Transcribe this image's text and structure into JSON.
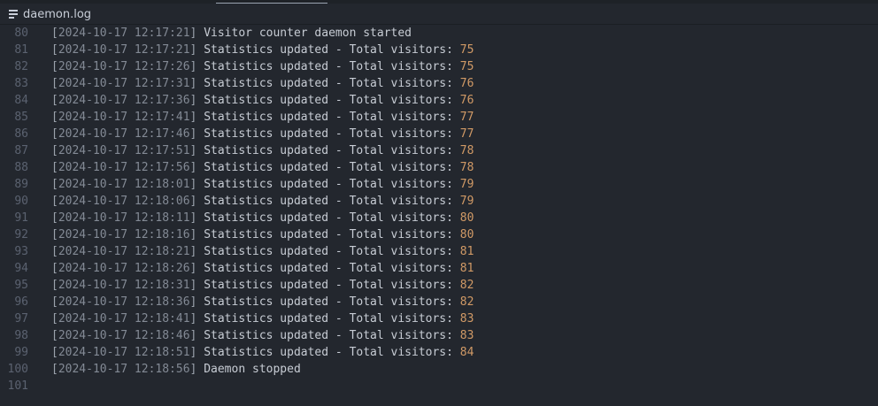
{
  "tab": {
    "filename": "daemon.log",
    "icon": "file-lines-icon"
  },
  "colors": {
    "background": "#23272e",
    "text": "#c7ccd4",
    "timestamp": "#838a95",
    "number": "#d19a66",
    "line_number": "#5b6270"
  },
  "lines": [
    {
      "num": "80",
      "ts": "2024-10-17 12:17:21",
      "msg": "Visitor counter daemon started",
      "value": ""
    },
    {
      "num": "81",
      "ts": "2024-10-17 12:17:21",
      "msg": "Statistics updated - Total visitors: ",
      "value": "75"
    },
    {
      "num": "82",
      "ts": "2024-10-17 12:17:26",
      "msg": "Statistics updated - Total visitors: ",
      "value": "75"
    },
    {
      "num": "83",
      "ts": "2024-10-17 12:17:31",
      "msg": "Statistics updated - Total visitors: ",
      "value": "76"
    },
    {
      "num": "84",
      "ts": "2024-10-17 12:17:36",
      "msg": "Statistics updated - Total visitors: ",
      "value": "76"
    },
    {
      "num": "85",
      "ts": "2024-10-17 12:17:41",
      "msg": "Statistics updated - Total visitors: ",
      "value": "77"
    },
    {
      "num": "86",
      "ts": "2024-10-17 12:17:46",
      "msg": "Statistics updated - Total visitors: ",
      "value": "77"
    },
    {
      "num": "87",
      "ts": "2024-10-17 12:17:51",
      "msg": "Statistics updated - Total visitors: ",
      "value": "78"
    },
    {
      "num": "88",
      "ts": "2024-10-17 12:17:56",
      "msg": "Statistics updated - Total visitors: ",
      "value": "78"
    },
    {
      "num": "89",
      "ts": "2024-10-17 12:18:01",
      "msg": "Statistics updated - Total visitors: ",
      "value": "79"
    },
    {
      "num": "90",
      "ts": "2024-10-17 12:18:06",
      "msg": "Statistics updated - Total visitors: ",
      "value": "79"
    },
    {
      "num": "91",
      "ts": "2024-10-17 12:18:11",
      "msg": "Statistics updated - Total visitors: ",
      "value": "80"
    },
    {
      "num": "92",
      "ts": "2024-10-17 12:18:16",
      "msg": "Statistics updated - Total visitors: ",
      "value": "80"
    },
    {
      "num": "93",
      "ts": "2024-10-17 12:18:21",
      "msg": "Statistics updated - Total visitors: ",
      "value": "81"
    },
    {
      "num": "94",
      "ts": "2024-10-17 12:18:26",
      "msg": "Statistics updated - Total visitors: ",
      "value": "81"
    },
    {
      "num": "95",
      "ts": "2024-10-17 12:18:31",
      "msg": "Statistics updated - Total visitors: ",
      "value": "82"
    },
    {
      "num": "96",
      "ts": "2024-10-17 12:18:36",
      "msg": "Statistics updated - Total visitors: ",
      "value": "82"
    },
    {
      "num": "97",
      "ts": "2024-10-17 12:18:41",
      "msg": "Statistics updated - Total visitors: ",
      "value": "83"
    },
    {
      "num": "98",
      "ts": "2024-10-17 12:18:46",
      "msg": "Statistics updated - Total visitors: ",
      "value": "83"
    },
    {
      "num": "99",
      "ts": "2024-10-17 12:18:51",
      "msg": "Statistics updated - Total visitors: ",
      "value": "84"
    },
    {
      "num": "100",
      "ts": "2024-10-17 12:18:56",
      "msg": "Daemon stopped",
      "value": ""
    },
    {
      "num": "101",
      "ts": "",
      "msg": "",
      "value": ""
    }
  ]
}
